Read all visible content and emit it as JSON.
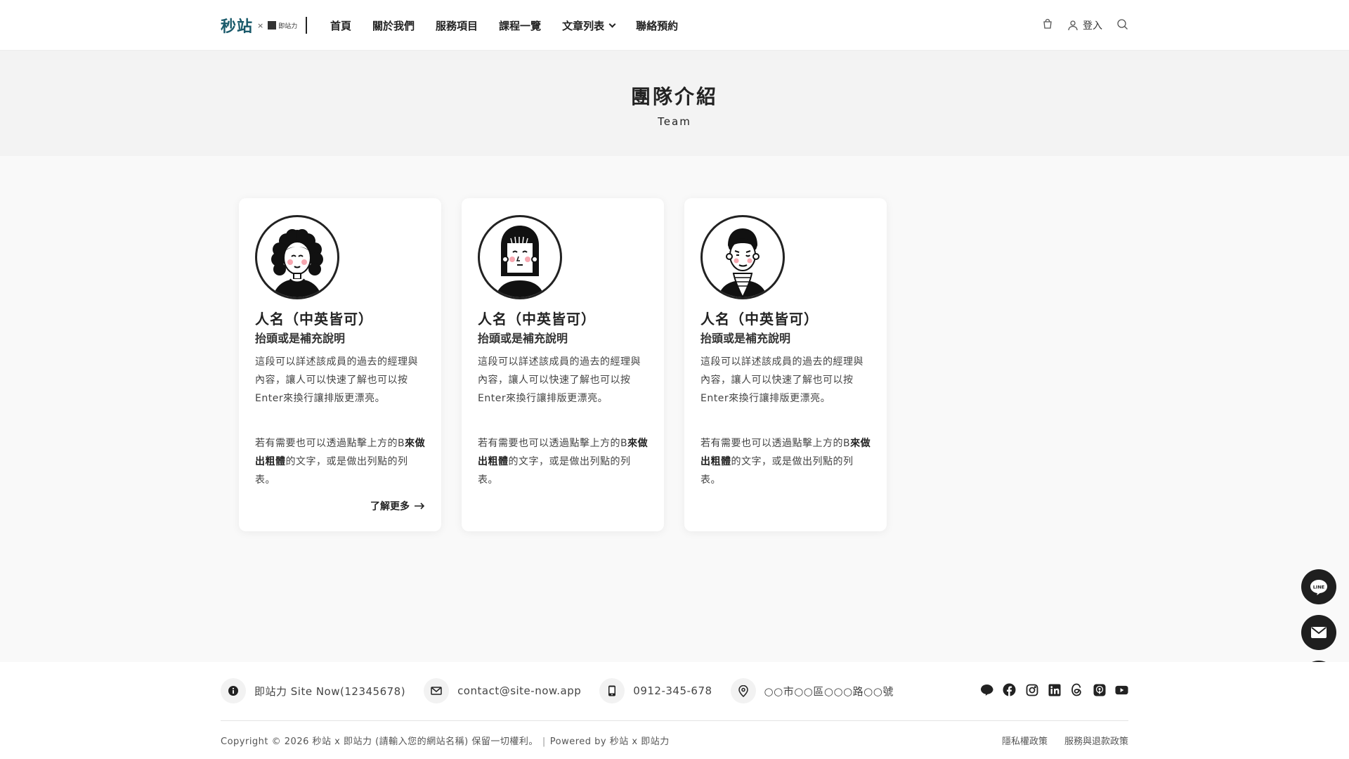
{
  "header": {
    "logo_main": "秒站",
    "logo_x": "×",
    "logo_sub": "即站力",
    "nav": [
      {
        "label": "首頁"
      },
      {
        "label": "關於我們"
      },
      {
        "label": "服務項目"
      },
      {
        "label": "課程一覽"
      },
      {
        "label": "文章列表",
        "has_dropdown": true
      },
      {
        "label": "聯絡預約"
      }
    ],
    "login_label": "登入",
    "icons": [
      "cart-icon",
      "user-icon",
      "search-icon"
    ]
  },
  "page_title": {
    "zh": "團隊介紹",
    "en": "Team"
  },
  "team": [
    {
      "name": "人名（中英皆可）",
      "role": "抬頭或是補充說明",
      "desc": "這段可以詳述該成員的過去的經理與內容，讓人可以快速了解也可以按Enter來換行讓排版更漂亮。",
      "desc2_pre": "若有需要也可以透過點擊上方的B",
      "desc2_bold": "來做出粗體",
      "desc2_post": "的文字，或是做出列點的列表。",
      "more_label": "了解更多",
      "avatar": "curly-hair-woman"
    },
    {
      "name": "人名（中英皆可）",
      "role": "抬頭或是補充說明",
      "desc": "這段可以詳述該成員的過去的經理與內容，讓人可以快速了解也可以按Enter來換行讓排版更漂亮。",
      "desc2_pre": "若有需要也可以透過點擊上方的B",
      "desc2_bold": "來做出粗體",
      "desc2_post": "的文字，或是做出列點的列表。",
      "avatar": "bangs-woman"
    },
    {
      "name": "人名（中英皆可）",
      "role": "抬頭或是補充說明",
      "desc": "這段可以詳述該成員的過去的經理與內容，讓人可以快速了解也可以按Enter來換行讓排版更漂亮。",
      "desc2_pre": "若有需要也可以透過點擊上方的B",
      "desc2_bold": "來做出粗體",
      "desc2_post": "的文字，或是做出列點的列表。",
      "avatar": "short-hair-man"
    }
  ],
  "floating_buttons": [
    "line-icon",
    "mail-icon",
    "translate-icon"
  ],
  "footer": {
    "company": "即站力 Site Now(12345678)",
    "email": "contact@site-now.app",
    "phone": "0912-345-678",
    "address": "○○市○○區○○○路○○號",
    "social_icons": [
      "line-icon",
      "facebook-icon",
      "instagram-icon",
      "linkedin-icon",
      "threads-icon",
      "podcast-icon",
      "youtube-icon"
    ],
    "copyright": "Copyright © 2026 秒站 x 即站力 (請輸入您的網站名稱) 保留一切權利。",
    "powered": "Powered by 秒站 x 即站力",
    "links": [
      "隱私權政策",
      "服務與退款政策"
    ]
  },
  "colors": {
    "brand": "#1a5a6b",
    "dark": "#1f1f1f",
    "bg": "#f9f9f9"
  }
}
